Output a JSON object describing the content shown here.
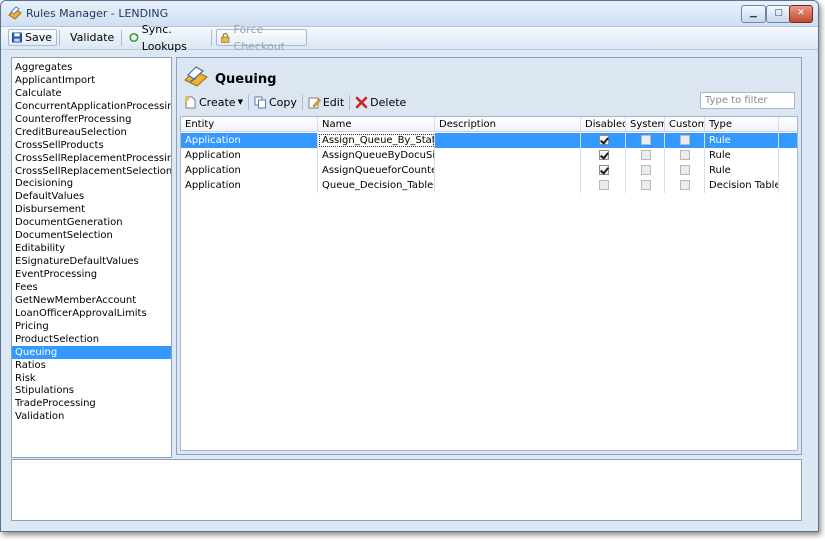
{
  "window": {
    "title": "Rules Manager - LENDING"
  },
  "toolbar": {
    "save": "Save",
    "validate": "Validate",
    "sync": "Sync. Lookups",
    "force_checkout": "Force Checkout"
  },
  "sidebar": {
    "items": [
      "Aggregates",
      "ApplicantImport",
      "Calculate",
      "ConcurrentApplicationProcessing",
      "CounterofferProcessing",
      "CreditBureauSelection",
      "CrossSellProducts",
      "CrossSellReplacementProcessing",
      "CrossSellReplacementSelection",
      "Decisioning",
      "DefaultValues",
      "Disbursement",
      "DocumentGeneration",
      "DocumentSelection",
      "Editability",
      "ESignatureDefaultValues",
      "EventProcessing",
      "Fees",
      "GetNewMemberAccount",
      "LoanOfficerApprovalLimits",
      "Pricing",
      "ProductSelection",
      "Queuing",
      "Ratios",
      "Risk",
      "Stipulations",
      "TradeProcessing",
      "Validation"
    ],
    "selected": "Queuing"
  },
  "panel": {
    "title": "Queuing",
    "create": "Create",
    "copy": "Copy",
    "edit": "Edit",
    "delete": "Delete",
    "filter_placeholder": "Type to filter"
  },
  "grid": {
    "headers": {
      "entity": "Entity",
      "name": "Name",
      "description": "Description",
      "disabled": "Disabled",
      "system": "System",
      "custom": "Custom",
      "type": "Type"
    },
    "rows": [
      {
        "entity": "Application",
        "name": "Assign_Queue_By_Status",
        "description": "",
        "disabled": true,
        "system": false,
        "custom": false,
        "type": "Rule"
      },
      {
        "entity": "Application",
        "name": "AssignQueueByDocuSignS",
        "description": "",
        "disabled": true,
        "system": false,
        "custom": false,
        "type": "Rule"
      },
      {
        "entity": "Application",
        "name": "AssignQueueforCounterof",
        "description": "",
        "disabled": true,
        "system": false,
        "custom": false,
        "type": "Rule"
      },
      {
        "entity": "Application",
        "name": "Queue_Decision_Table",
        "description": "",
        "disabled": false,
        "system": false,
        "custom": false,
        "type": "Decision Table"
      }
    ],
    "selected_row": 0
  },
  "colors": {
    "selection": "#3399ff",
    "frame": "#dde8f5",
    "border": "#8da2bd"
  }
}
